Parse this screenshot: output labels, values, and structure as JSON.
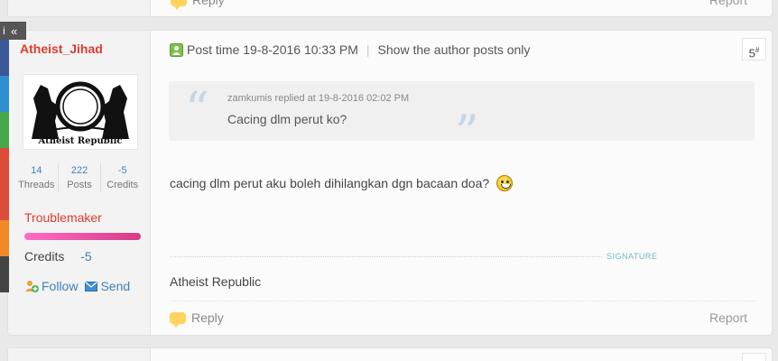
{
  "prev_post": {
    "reply_label": "Reply",
    "report_label": "Report"
  },
  "post": {
    "author": {
      "username": "Atheist_Jihad",
      "avatar_caption": "Atheist Republic",
      "stats": [
        {
          "value": "14",
          "label": "Threads"
        },
        {
          "value": "222",
          "label": "Posts"
        },
        {
          "value": "-5",
          "label": "Credits"
        }
      ],
      "rank_title": "Troublemaker",
      "credits_label": "Credits",
      "credits_value": "-5",
      "follow_label": "Follow",
      "send_label": "Send"
    },
    "header": {
      "post_time": "Post time 19-8-2016 10:33 PM",
      "author_only": "Show the author posts only",
      "floor": "5",
      "floor_sup": "#"
    },
    "quote": {
      "meta": "zamkumis replied at 19-8-2016 02:02 PM",
      "text": "Cacing dlm perut ko?"
    },
    "body": "cacing dlm perut aku boleh dihilangkan dgn bacaan doa?",
    "signature_label": "SIGNATURE",
    "signature": "Atheist Republic",
    "reply_label": "Reply",
    "report_label": "Report"
  },
  "sidebar_tab": {
    "icon": "i",
    "chevron": "«"
  },
  "colors": {
    "username": "#e03b2b",
    "link": "#3f7fb9",
    "rank_bar": "#e05aa8",
    "sidebar": [
      "#3b5998",
      "#2f8fd0",
      "#45a84a",
      "#dd4b39",
      "#f08a24",
      "#444444"
    ]
  }
}
